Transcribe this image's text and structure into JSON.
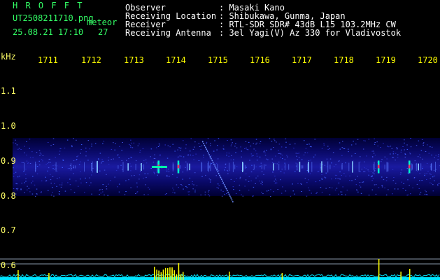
{
  "header": {
    "logo": "H R O F F T",
    "filename": "UT2508211710.png",
    "tag": "meteor",
    "date": "25.08.21 17:10",
    "count": "27",
    "info_labels": [
      "Observer",
      "Receiving Location",
      "Receiver",
      "Receiving Antenna"
    ],
    "info_values": [
      ": Masaki Kano",
      ": Shibukawa, Gunma, Japan",
      ": RTL-SDR SDR# 43dB L15 103.2MHz CW",
      ": 3el Yagi(V) Az 330 for Vladivostok"
    ]
  },
  "time_axis": {
    "labels": [
      "1711",
      "1712",
      "1713",
      "1714",
      "1715",
      "1716",
      "1717",
      "1718",
      "1719",
      "1720"
    ]
  },
  "freq_axis": {
    "unit": "kHz",
    "labels": [
      "1.1",
      "1.0",
      "0.9",
      "0.8",
      "0.7",
      "0.6"
    ]
  },
  "colors": {
    "header_green": "#33ff66",
    "tick_yellow": "#ffff00",
    "noise_blue": "#1a1aa0",
    "noise_line_cyan": "#00e5ff",
    "spike_yellow": "#ffff00"
  },
  "chart_data": {
    "type": "heatmap",
    "x_range": [
      1710,
      1720
    ],
    "y_range": [
      0.55,
      1.2
    ],
    "band_center_khz": 0.9,
    "band_extent_khz": [
      0.81,
      0.99
    ],
    "meteor_echoes_min": [
      1712.2,
      1712.9,
      1713.2,
      1713.6,
      1714.05,
      1714.3,
      1715.5,
      1716.2,
      1716.8,
      1717.0,
      1717.3,
      1718.0,
      1718.6,
      1719.3,
      1719.5
    ],
    "strong_echo_min": [
      1713.6,
      1714.05,
      1718.6,
      1719.3
    ],
    "aircraft_trace": {
      "start": [
        1714.6,
        0.98
      ],
      "end": [
        1715.3,
        0.79
      ]
    },
    "signal_spikes_min": [
      1710.4,
      1711.1,
      1713.5,
      1713.9,
      1714.05,
      1715.2,
      1716.4,
      1718.6,
      1719.1,
      1719.3
    ]
  }
}
